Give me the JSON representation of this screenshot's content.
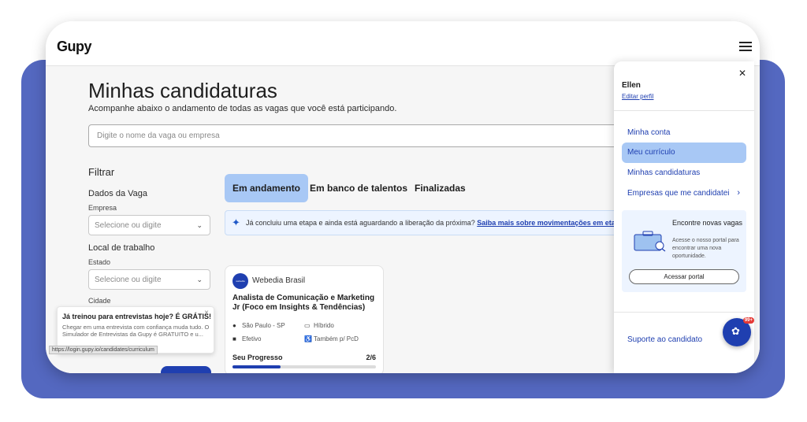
{
  "header": {
    "logo": "Gupy"
  },
  "page": {
    "title": "Minhas candidaturas",
    "subtitle": "Acompanhe abaixo o andamento de todas as vagas que você está participando.",
    "search_placeholder": "Digite o nome da vaga ou empresa"
  },
  "filters": {
    "title": "Filtrar",
    "section_job": "Dados da Vaga",
    "company_label": "Empresa",
    "company_placeholder": "Selecione ou digite",
    "section_location": "Local de trabalho",
    "state_label": "Estado",
    "state_placeholder": "Selecione ou digite",
    "city_label": "Cidade"
  },
  "tabs": [
    "Em andamento",
    "Em banco de talentos",
    "Finalizadas"
  ],
  "info": {
    "text": "Já concluiu uma etapa e ainda está aguardando a liberação da próxima?",
    "link": "Saiba mais sobre movimentações em etapas"
  },
  "card": {
    "company": "Webedia Brasil",
    "logo_text": "webedia",
    "title": "Analista de Comunicação e Marketing Jr (Foco em Insights & Tendências)",
    "location": "São Paulo - SP",
    "workplace": "Híbrido",
    "contract": "Efetivo",
    "pcd": "Também p/ PcD",
    "progress_label": "Seu Progresso",
    "progress_text": "2/6",
    "progress_fraction": 0.333
  },
  "toast": {
    "title": "Já treinou para entrevistas hoje? É GRÁTIS!",
    "body": "Chegar em uma entrevista com confiança muda tudo. O Simulador de Entrevistas da Gupy é GRATUITO e u..."
  },
  "status_url": "https://login.gupy.io/candidates/curriculum",
  "panel": {
    "user_name": "Ellen",
    "edit_profile": "Editar perfil",
    "menu": [
      "Minha conta",
      "Meu currículo",
      "Minhas candidaturas",
      "Empresas que me candidatei"
    ],
    "promo_title": "Encontre novas vagas",
    "promo_desc": "Acesse o nosso portal para encontrar uma nova oportunidade.",
    "promo_button": "Acessar portal",
    "support": "Suporte ao candidato"
  },
  "chat": {
    "badge": "99+"
  },
  "colors": {
    "brand_blue": "#1f3fb0",
    "active_highlight": "#a8c8f5",
    "backdrop": "#5468c0"
  },
  "icons": [
    "hamburger-icon",
    "close-icon",
    "chevron-down-icon",
    "sparkle-icon",
    "pin-icon",
    "monitor-icon",
    "briefcase-icon",
    "accessibility-icon",
    "chevron-right-icon",
    "chat-icon"
  ]
}
